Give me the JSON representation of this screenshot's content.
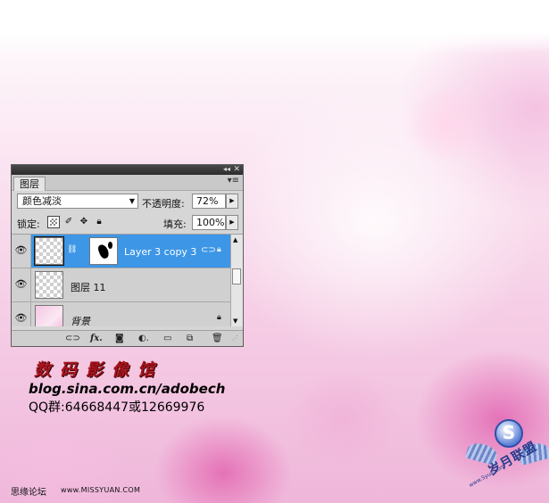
{
  "layers_panel": {
    "tab_label": "图层",
    "blend_mode": "颜色减淡",
    "opacity_label": "不透明度:",
    "opacity_value": "72%",
    "lock_label": "锁定:",
    "fill_label": "填充:",
    "fill_value": "100%",
    "layers": [
      {
        "name": "Layer 3 copy 3",
        "selected": true,
        "visible": true
      },
      {
        "name": "图层 11",
        "selected": false,
        "visible": true
      },
      {
        "name": "背景",
        "selected": false,
        "visible": true,
        "locked": true
      }
    ],
    "icons": {
      "visibility": "eye-icon",
      "chain": "chain-link-icon",
      "lock": "lock-icon"
    }
  },
  "watermark": {
    "title": "数码影像馆",
    "blog": "blog.sina.com.cn/adobech",
    "qq": "QQ群:64668447或12669976"
  },
  "footer": {
    "forum": "思缘论坛",
    "url": "www.MISSYUAN.COM"
  },
  "logo": {
    "mark": "S",
    "text": "岁月联盟",
    "subtext": "www.Syue.com"
  },
  "colors": {
    "selected_layer": "#3d96e6",
    "watermark_title": "#a8141e",
    "logo_blue": "#243c8c"
  }
}
